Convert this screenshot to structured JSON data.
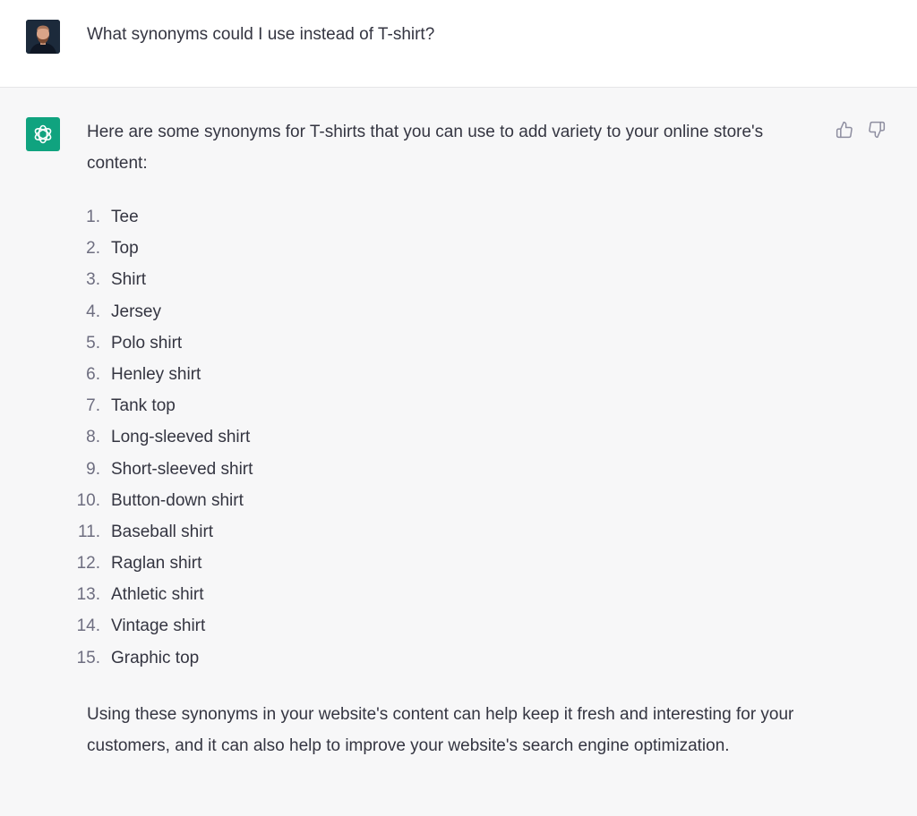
{
  "user": {
    "message": "What synonyms could I use instead of T-shirt?"
  },
  "assistant": {
    "intro": "Here are some synonyms for T-shirts that you can use to add variety to your online store's content:",
    "items": [
      {
        "num": "1.",
        "text": "Tee"
      },
      {
        "num": "2.",
        "text": "Top"
      },
      {
        "num": "3.",
        "text": "Shirt"
      },
      {
        "num": "4.",
        "text": "Jersey"
      },
      {
        "num": "5.",
        "text": "Polo shirt"
      },
      {
        "num": "6.",
        "text": "Henley shirt"
      },
      {
        "num": "7.",
        "text": "Tank top"
      },
      {
        "num": "8.",
        "text": "Long-sleeved shirt"
      },
      {
        "num": "9.",
        "text": "Short-sleeved shirt"
      },
      {
        "num": "10.",
        "text": "Button-down shirt"
      },
      {
        "num": "11.",
        "text": "Baseball shirt"
      },
      {
        "num": "12.",
        "text": "Raglan shirt"
      },
      {
        "num": "13.",
        "text": "Athletic shirt"
      },
      {
        "num": "14.",
        "text": "Vintage shirt"
      },
      {
        "num": "15.",
        "text": "Graphic top"
      }
    ],
    "outro": "Using these synonyms in your website's content can help keep it fresh and interesting for your customers, and it can also help to improve your website's search engine optimization."
  },
  "icons": {
    "user_avatar": "avatar",
    "bot_logo": "openai-logo-icon",
    "thumbs_up": "thumbs-up-icon",
    "thumbs_down": "thumbs-down-icon"
  },
  "colors": {
    "brand": "#10a37f",
    "background": "#f7f7f8",
    "user_background": "#ffffff",
    "text": "#343541",
    "muted": "#6e6e80"
  }
}
